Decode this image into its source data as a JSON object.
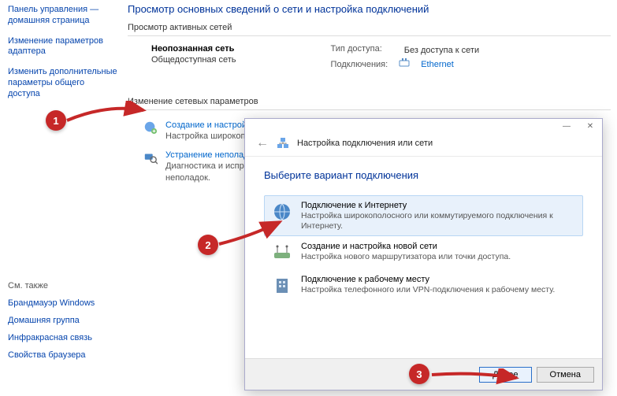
{
  "sidebar": {
    "items": [
      "Панель управления — домашняя страница",
      "Изменение параметров адаптера",
      "Изменить дополнительные параметры общего доступа"
    ]
  },
  "see_also": {
    "header": "См. также",
    "items": [
      "Брандмауэр Windows",
      "Домашняя группа",
      "Инфракрасная связь",
      "Свойства браузера"
    ]
  },
  "main": {
    "title": "Просмотр основных сведений о сети и настройка подключений",
    "active_header": "Просмотр активных сетей",
    "network": {
      "name": "Неопознанная сеть",
      "type": "Общедоступная сеть",
      "access_label": "Тип доступа:",
      "access_value": "Без доступа к сети",
      "conn_label": "Подключения:",
      "conn_value": "Ethernet"
    },
    "params_header": "Изменение сетевых параметров",
    "tasks": [
      {
        "title": "Создание и настройка нового подключения или сети",
        "desc": "Настройка широкополосного, коммутируемого или VPN-подключения либо настройка маршрутизатора или"
      },
      {
        "title": "Устранение неполад",
        "desc": "Диагностика и испра\nнеполадок."
      }
    ]
  },
  "wizard": {
    "title": "Настройка подключения или сети",
    "heading": "Выберите вариант подключения",
    "options": [
      {
        "title": "Подключение к Интернету",
        "desc": "Настройка широкополосного или коммутируемого подключения к Интернету."
      },
      {
        "title": "Создание и настройка новой сети",
        "desc": "Настройка нового маршрутизатора или точки доступа."
      },
      {
        "title": "Подключение к рабочему месту",
        "desc": "Настройка телефонного или VPN-подключения к рабочему месту."
      }
    ],
    "next": "Далее",
    "cancel": "Отмена"
  },
  "badges": {
    "b1": "1",
    "b2": "2",
    "b3": "3"
  }
}
